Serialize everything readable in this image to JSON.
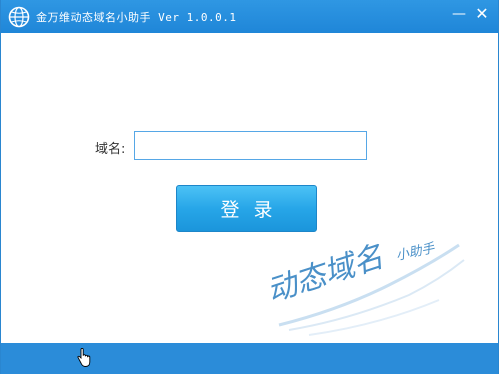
{
  "window": {
    "title": "金万维动态域名小助手 Ver 1.0.0.1",
    "minimize_glyph": "—",
    "close_glyph": "✕"
  },
  "form": {
    "domain_label": "域名:",
    "domain_value": "",
    "login_label": "登录"
  },
  "watermark": {
    "main_text": "动态域名",
    "sub_text": "小助手"
  },
  "icons": {
    "app": "globe-icon",
    "cursor": "hand-cursor-icon"
  },
  "colors": {
    "titlebar": "#2f97e3",
    "button": "#27a6e8",
    "statusbar": "#2b8cd9",
    "input_border": "#56a7e6",
    "watermark": "#4a90c8"
  }
}
